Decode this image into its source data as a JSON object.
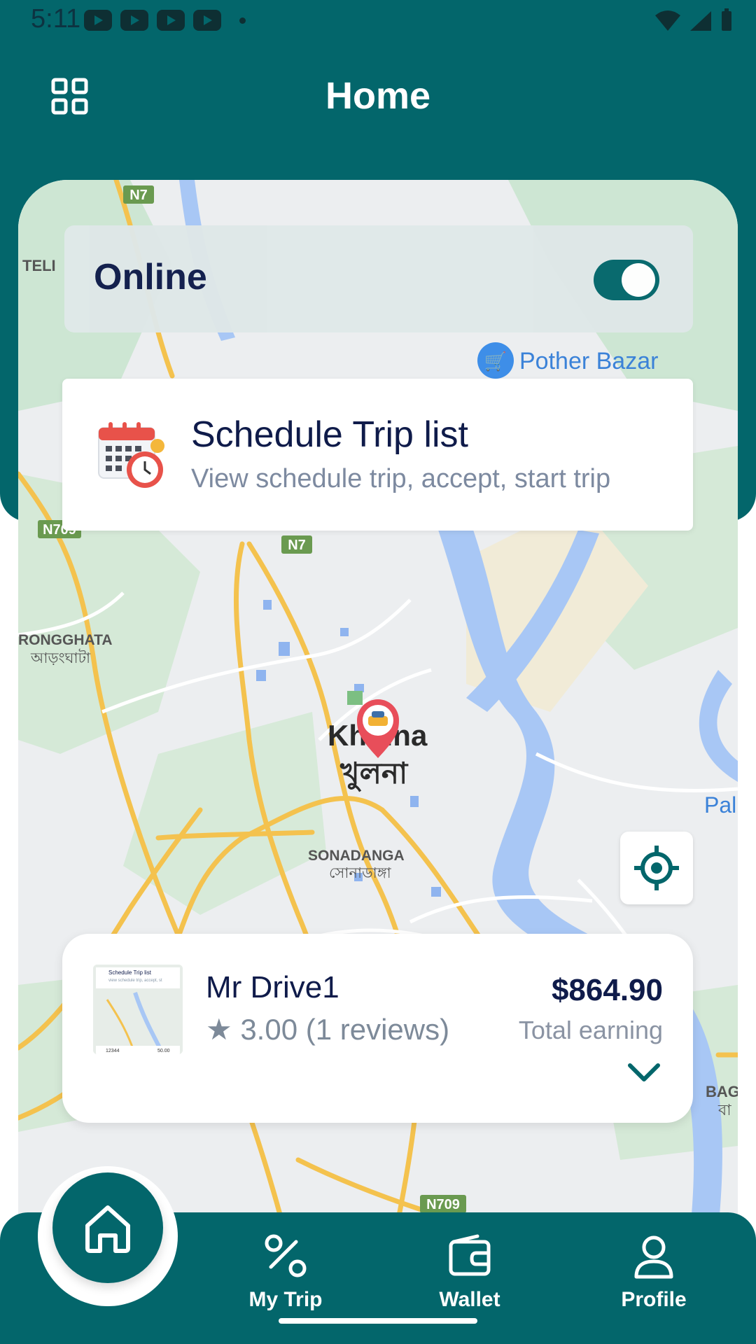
{
  "status_bar": {
    "time": "5:11"
  },
  "header": {
    "title": "Home",
    "menu_icon": "grid-icon"
  },
  "online": {
    "label": "Online",
    "toggle_on": true
  },
  "schedule": {
    "title": "Schedule Trip list",
    "subtitle": "View schedule trip, accept, start trip"
  },
  "map": {
    "labels": {
      "n7_top": "N7",
      "teli": "TELI",
      "pother_bazar": "Pother Bazar",
      "n709_left": "N709",
      "n7_mid": "N7",
      "rongghata": "RONGGHATA",
      "rongghata_bn": "আড়ংঘাটা",
      "khulna": "Khulna",
      "khulna_bn": "খুলনা",
      "sonadanga": "SONADANGA",
      "sonadanga_bn": "সোনাডাঙ্গা",
      "pal": "Pal",
      "bag": "BAG",
      "bag_bn": "বা",
      "n709_bottom": "N709"
    }
  },
  "driver": {
    "name": "Mr Drive1",
    "rating": "★ 3.00 (1 reviews)",
    "earning": "$864.90",
    "earning_label": "Total earning",
    "thumb": {
      "title": "Schedule Trip list",
      "subtitle": "view schedule trip, accept, st",
      "id": "12344",
      "amount": "50.00"
    }
  },
  "nav": {
    "home": "Home",
    "my_trip": "My Trip",
    "wallet": "Wallet",
    "profile": "Profile"
  },
  "colors": {
    "primary": "#03666b",
    "text_dark": "#0f1b4a",
    "text_muted": "#7d8aa0"
  }
}
